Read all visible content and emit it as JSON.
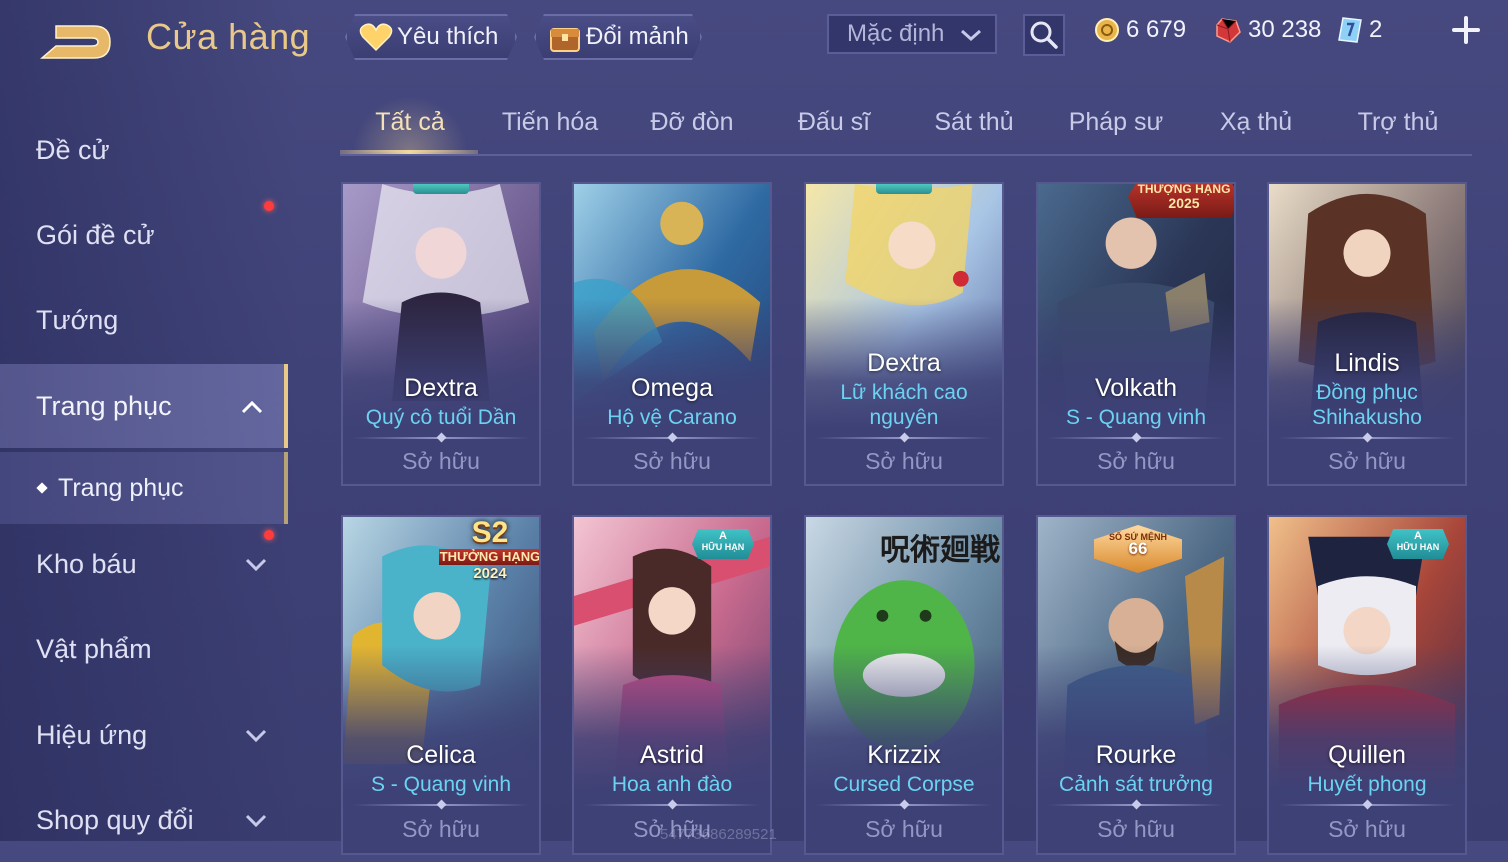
{
  "header": {
    "title": "Cửa hàng",
    "favorite_label": "Yêu thích",
    "exchange_label": "Đổi mảnh",
    "sort_value": "Mặc định",
    "currencies": [
      {
        "icon": "gold-coin-icon",
        "value": "6 679"
      },
      {
        "icon": "red-gem-icon",
        "value": "30 238"
      },
      {
        "icon": "voucher-icon",
        "value": "2"
      }
    ]
  },
  "sidebar": {
    "items": [
      {
        "label": "Đề cử"
      },
      {
        "label": "Gói đề cử"
      },
      {
        "label": "Tướng"
      },
      {
        "label": "Trang phục"
      },
      {
        "label": "Kho báu"
      },
      {
        "label": "Vật phẩm"
      },
      {
        "label": "Hiệu ứng"
      },
      {
        "label": "Shop quy đổi"
      }
    ],
    "sub_item": "Trang phục"
  },
  "tabs": [
    "Tất cả",
    "Tiến hóa",
    "Đỡ đòn",
    "Đấu sĩ",
    "Sát thủ",
    "Pháp sư",
    "Xạ thủ",
    "Trợ thủ"
  ],
  "cards": [
    {
      "hero": "Dextra",
      "skin": "Quý cô tuổi Dần",
      "status": "Sở hữu"
    },
    {
      "hero": "Omega",
      "skin": "Hộ vệ Carano",
      "status": "Sở hữu"
    },
    {
      "hero": "Dextra",
      "skin": "Lữ khách cao nguyên",
      "status": "Sở hữu"
    },
    {
      "hero": "Volkath",
      "skin": "S - Quang vinh",
      "status": "Sở hữu",
      "badge_line1": "THƯỢNG HẠNG",
      "badge_line2": "2025"
    },
    {
      "hero": "Lindis",
      "skin": "Đồng phục Shihakusho",
      "status": "Sở hữu"
    },
    {
      "hero": "Celica",
      "skin": "S - Quang vinh",
      "status": "Sở hữu",
      "badge_big": "S2",
      "badge_line1": "THƯỞNG HẠNG",
      "badge_line2": "2024"
    },
    {
      "hero": "Astrid",
      "skin": "Hoa anh đào",
      "status": "Sở hữu",
      "badge_a": "A",
      "badge_a_sub": "HỮU HẠN"
    },
    {
      "hero": "Krizzix",
      "skin": "Cursed Corpse",
      "status": "Sở hữu",
      "art_text": "呪術廻戦"
    },
    {
      "hero": "Rourke",
      "skin": "Cảnh sát trưởng",
      "status": "Sở hữu",
      "badge_small": "SỐ SỨ MỆNH",
      "badge_num": "66"
    },
    {
      "hero": "Quillen",
      "skin": "Huyết phong",
      "status": "Sở hữu",
      "badge_a": "A",
      "badge_a_sub": "HỮU HẠN"
    }
  ],
  "watermark": "54773686289521",
  "colors": {
    "accent": "#e8c98a",
    "skin_name": "#6cd2f2",
    "background": "#42457b"
  }
}
